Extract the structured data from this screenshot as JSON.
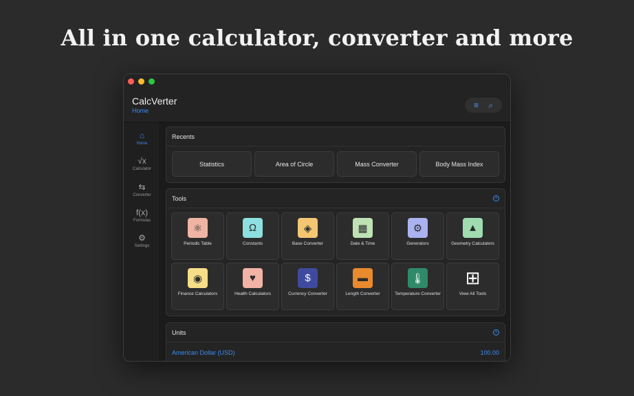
{
  "headline": "All in one calculator, converter and more",
  "app": {
    "title": "CalcVerter",
    "subtitle": "Home"
  },
  "toolbar": {
    "filter_icon": "filter-icon",
    "search_icon": "search-icon"
  },
  "sidebar": {
    "items": [
      {
        "label": "Home",
        "icon": "⌂",
        "active": true
      },
      {
        "label": "Calculator",
        "icon": "√x",
        "active": false
      },
      {
        "label": "Converter",
        "icon": "⇆",
        "active": false
      },
      {
        "label": "Formulas",
        "icon": "f(x)",
        "active": false
      },
      {
        "label": "Settings",
        "icon": "⚙",
        "active": false
      }
    ]
  },
  "recents": {
    "title": "Recents",
    "items": [
      "Statistics",
      "Area of Circle",
      "Mass Converter",
      "Body Mass Index"
    ]
  },
  "tools": {
    "title": "Tools",
    "items": [
      {
        "label": "Periodic Table",
        "icon": "⚛",
        "color": "#f0b4a4"
      },
      {
        "label": "Constants",
        "icon": "Ω",
        "color": "#8ee0e0"
      },
      {
        "label": "Base Converter",
        "icon": "◈",
        "color": "#f3c772"
      },
      {
        "label": "Date & Time",
        "icon": "▦",
        "color": "#bfe2b4"
      },
      {
        "label": "Generators",
        "icon": "⚙",
        "color": "#a9b3f0"
      },
      {
        "label": "Geometry Calculators",
        "icon": "▲",
        "color": "#9fdcb0"
      },
      {
        "label": "Finance Calculators",
        "icon": "◉",
        "color": "#f6dd88"
      },
      {
        "label": "Health Calculators",
        "icon": "♥",
        "color": "#f2b3a7"
      },
      {
        "label": "Currency Converter",
        "icon": "$",
        "color": "#3f4a9e"
      },
      {
        "label": "Length Converter",
        "icon": "▬",
        "color": "#e98a2c"
      },
      {
        "label": "Temperature Converter",
        "icon": "🌡",
        "color": "#2f8a6a"
      },
      {
        "label": "View All Tools",
        "icon": "⊞",
        "color": "#2c2c2c"
      }
    ]
  },
  "units": {
    "title": "Units",
    "row_label": "American Dollar (USD)",
    "row_value": "100.00"
  },
  "colors": {
    "accent": "#3b8cf0",
    "background": "#2b2b2b"
  }
}
